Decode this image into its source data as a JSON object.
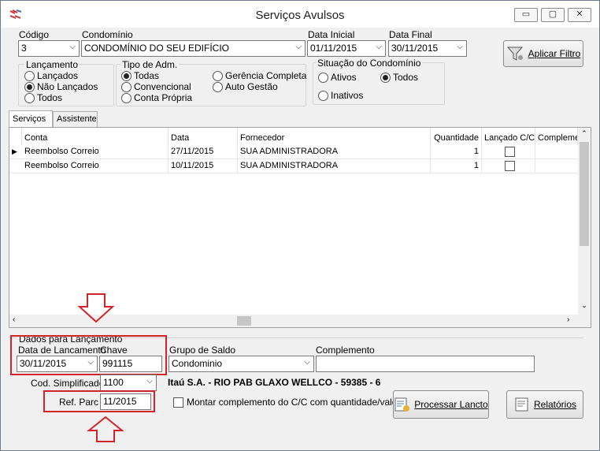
{
  "window": {
    "title": "Serviços Avulsos",
    "minimize": "▭",
    "maximize": "▢",
    "close": "✕"
  },
  "filters": {
    "codigo_label": "Código",
    "codigo_value": "3",
    "condominio_label": "Condomínio",
    "condominio_value": "CONDOMÍNIO DO SEU EDIFÍCIO",
    "data_inicial_label": "Data Inicial",
    "data_inicial_value": "01/11/2015",
    "data_final_label": "Data Final",
    "data_final_value": "30/11/2015",
    "aplicar_label": "Aplicar Filtro"
  },
  "lancamento": {
    "title": "Lançamento",
    "options": [
      "Lançados",
      "Não Lançados",
      "Todos"
    ],
    "selected": 1
  },
  "tipo_adm": {
    "title": "Tipo de Adm.",
    "options": [
      "Todas",
      "Convencional",
      "Conta Própria",
      "Gerência Completa",
      "Auto Gestão"
    ],
    "selected": 0
  },
  "situacao": {
    "title": "Situação do Condomínio",
    "options": [
      "Ativos",
      "Todos",
      "Inativos"
    ],
    "selected": 1
  },
  "tabs": [
    "Serviços",
    "Assistente"
  ],
  "grid": {
    "columns": [
      "Conta",
      "Data",
      "Fornecedor",
      "Quantidade",
      "Lançado C/C",
      "Compleme"
    ],
    "rows": [
      {
        "conta": "Reembolso Correio",
        "data": "27/11/2015",
        "fornecedor": "SUA ADMINISTRADORA",
        "quantidade": "1",
        "lancado": false
      },
      {
        "conta": "Reembolso Correio",
        "data": "10/11/2015",
        "fornecedor": "SUA ADMINISTRADORA",
        "quantidade": "1",
        "lancado": false
      }
    ]
  },
  "dados": {
    "title": "Dados para Lançamento",
    "data_lancamento_label": "Data de Lancamento",
    "data_lancamento_value": "30/11/2015",
    "chave_label": "Chave",
    "chave_value": "991115",
    "grupo_label": "Grupo de Saldo",
    "grupo_value": "Condominio",
    "complemento_label": "Complemento",
    "complemento_value": "",
    "cod_label": "Cod. Simplificado",
    "cod_value": "1100",
    "bank_info": "Itaú S.A. - RIO PAB GLAXO WELLCO - 59385 - 6",
    "ref_label": "Ref. Parc",
    "ref_value": "11/2015",
    "montar_label": "Montar complemento do C/C com quantidade/valor",
    "processar_label": "Processar Lancto",
    "relatorios_label": "Relatórios"
  },
  "colors": {
    "annotation": "#d2232a",
    "window_bg": "#f0f0f0"
  }
}
